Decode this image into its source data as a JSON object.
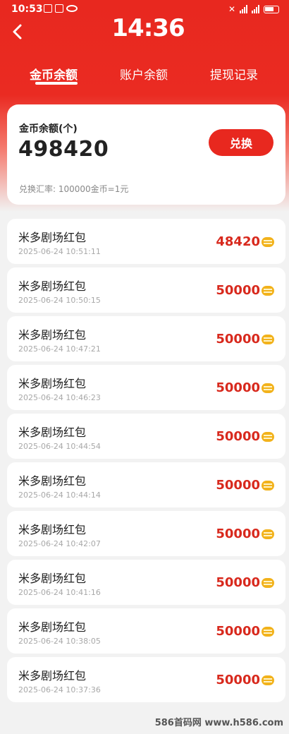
{
  "status": {
    "time": "10:53"
  },
  "header": {
    "title": "14:36"
  },
  "tabs": [
    {
      "label": "金币余额",
      "active": true
    },
    {
      "label": "账户余额",
      "active": false
    },
    {
      "label": "提现记录",
      "active": false
    }
  ],
  "balance": {
    "label": "金币余额(个)",
    "value": "498420",
    "exchange_label": "兑换",
    "rate": "兑换汇率:  100000金币=1元"
  },
  "records": [
    {
      "title": "米多剧场红包",
      "time": "2025-06-24 10:51:11",
      "amount": "48420"
    },
    {
      "title": "米多剧场红包",
      "time": "2025-06-24 10:50:15",
      "amount": "50000"
    },
    {
      "title": "米多剧场红包",
      "time": "2025-06-24 10:47:21",
      "amount": "50000"
    },
    {
      "title": "米多剧场红包",
      "time": "2025-06-24 10:46:23",
      "amount": "50000"
    },
    {
      "title": "米多剧场红包",
      "time": "2025-06-24 10:44:54",
      "amount": "50000"
    },
    {
      "title": "米多剧场红包",
      "time": "2025-06-24 10:44:14",
      "amount": "50000"
    },
    {
      "title": "米多剧场红包",
      "time": "2025-06-24 10:42:07",
      "amount": "50000"
    },
    {
      "title": "米多剧场红包",
      "time": "2025-06-24 10:41:16",
      "amount": "50000"
    },
    {
      "title": "米多剧场红包",
      "time": "2025-06-24 10:38:05",
      "amount": "50000"
    },
    {
      "title": "米多剧场红包",
      "time": "2025-06-24 10:37:36",
      "amount": "50000"
    }
  ],
  "icons": {
    "back": "back-arrow-icon",
    "coin": "coin-stack-icon"
  },
  "colors": {
    "primary": "#e8281f",
    "amount": "#d8291d"
  },
  "watermark": "586首码网 www.h586.com"
}
